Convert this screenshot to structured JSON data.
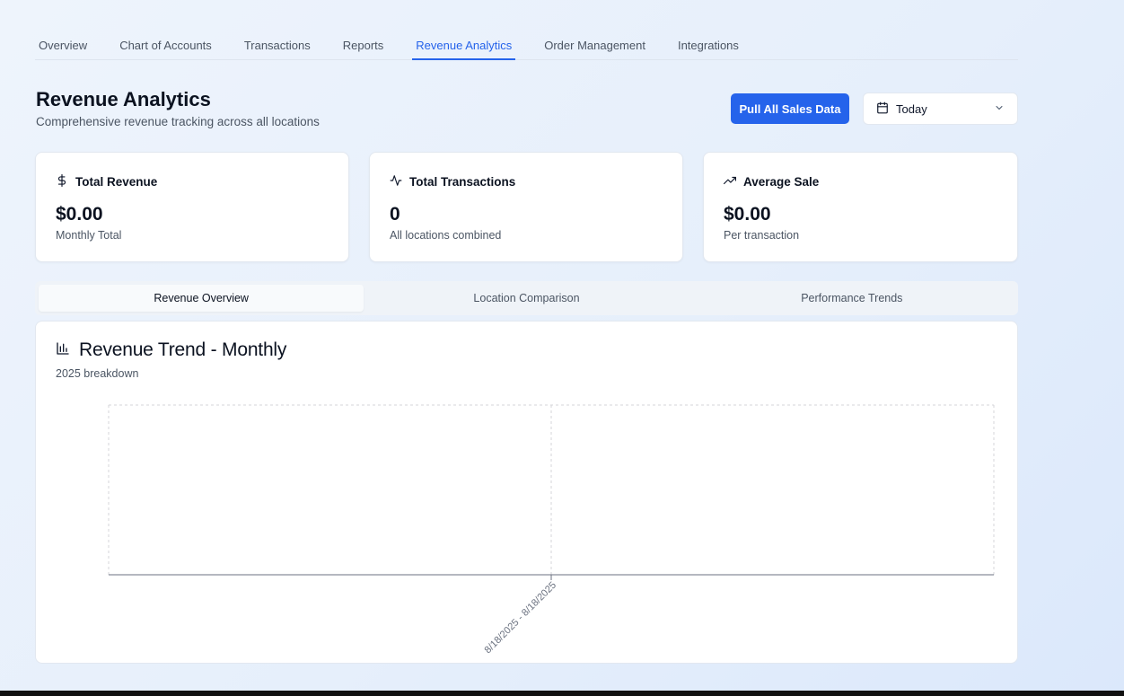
{
  "nav": {
    "tabs": [
      {
        "label": "Overview"
      },
      {
        "label": "Chart of Accounts"
      },
      {
        "label": "Transactions"
      },
      {
        "label": "Reports"
      },
      {
        "label": "Revenue Analytics"
      },
      {
        "label": "Order Management"
      },
      {
        "label": "Integrations"
      }
    ],
    "active_tab": "Revenue Analytics"
  },
  "header": {
    "title": "Revenue Analytics",
    "subtitle": "Comprehensive revenue tracking across all locations",
    "pull_button": "Pull All Sales Data",
    "date_range": {
      "selected": "Today",
      "icon": "calendar-icon"
    }
  },
  "stats": [
    {
      "icon": "dollar-icon",
      "label": "Total Revenue",
      "value": "$0.00",
      "caption": "Monthly Total"
    },
    {
      "icon": "activity-icon",
      "label": "Total Transactions",
      "value": "0",
      "caption": "All locations combined"
    },
    {
      "icon": "trending-up-icon",
      "label": "Average Sale",
      "value": "$0.00",
      "caption": "Per transaction"
    }
  ],
  "subtabs": [
    {
      "label": "Revenue Overview"
    },
    {
      "label": "Location Comparison"
    },
    {
      "label": "Performance Trends"
    }
  ],
  "active_subtab": "Revenue Overview",
  "chart": {
    "icon": "bar-chart-icon",
    "title": "Revenue Trend - Monthly",
    "subtitle": "2025 breakdown"
  },
  "chart_data": {
    "type": "line",
    "x": [
      "8/18/2025 - 8/18/2025"
    ],
    "series": [
      {
        "values": [
          0
        ]
      }
    ],
    "title": "Revenue Trend - Monthly",
    "subtitle": "2025 breakdown",
    "xlabel": "",
    "ylabel": "",
    "grid": true
  }
}
